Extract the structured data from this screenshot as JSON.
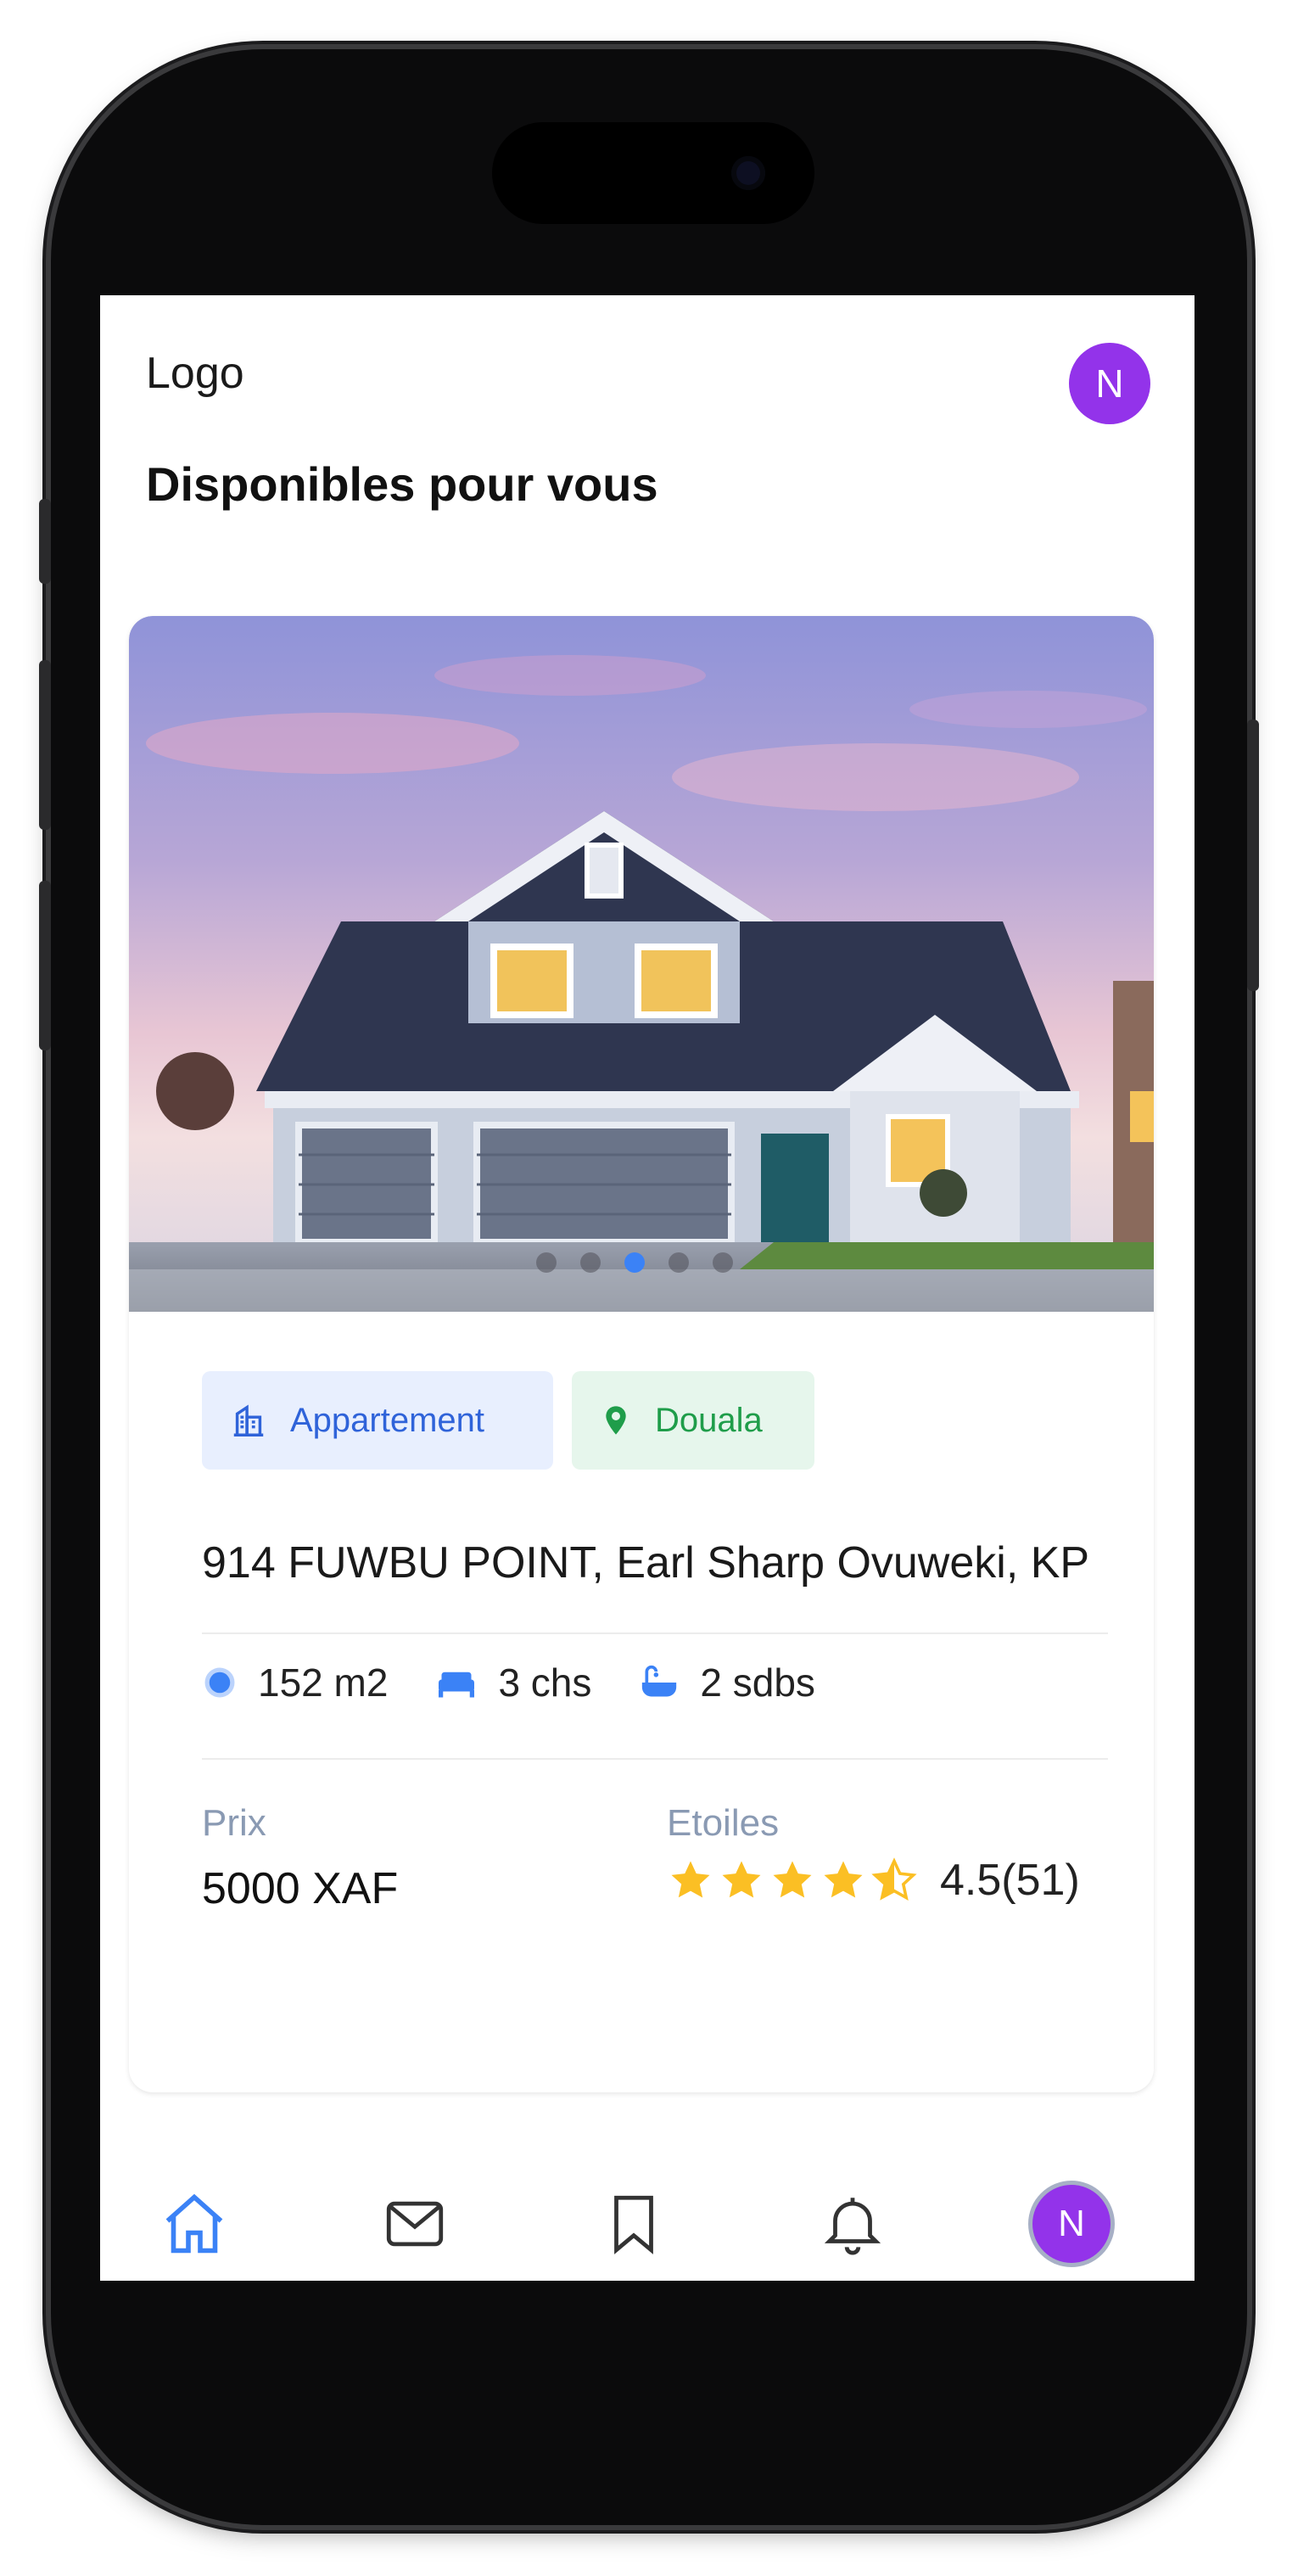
{
  "header": {
    "logo_text": "Logo",
    "avatar_initial": "N"
  },
  "section": {
    "title": "Disponibles pour vous"
  },
  "listing": {
    "image_alt": "House photo",
    "carousel": {
      "count": 5,
      "active_index": 2
    },
    "tags": [
      {
        "label": "Appartement",
        "icon": "building-icon",
        "color": "#2f63d9",
        "bg": "#e8effe"
      },
      {
        "label": "Douala",
        "icon": "location-pin-icon",
        "color": "#1f9d4a",
        "bg": "#e6f6ec"
      }
    ],
    "address": "914 FUWBU POINT, Earl Sharp Ovuweki, KP",
    "features": [
      {
        "icon": "area-icon",
        "text": "152 m2"
      },
      {
        "icon": "bed-icon",
        "text": "3 chs"
      },
      {
        "icon": "bathtub-icon",
        "text": "2 sdbs"
      }
    ],
    "price_label": "Prix",
    "price_value": "5000 XAF",
    "stars_label": "Etoiles",
    "rating": {
      "stars": 4.5,
      "text": "4.5(51)"
    }
  },
  "bottom_nav": {
    "items": [
      {
        "icon": "home-icon",
        "active": true
      },
      {
        "icon": "mail-icon",
        "active": false
      },
      {
        "icon": "bookmark-icon",
        "active": false
      },
      {
        "icon": "bell-icon",
        "active": false
      },
      {
        "icon": "profile-avatar",
        "active": false
      }
    ],
    "avatar_initial": "N"
  },
  "colors": {
    "accent": "#3b82f6",
    "avatar": "#9333ea",
    "star": "#fbbf24"
  }
}
